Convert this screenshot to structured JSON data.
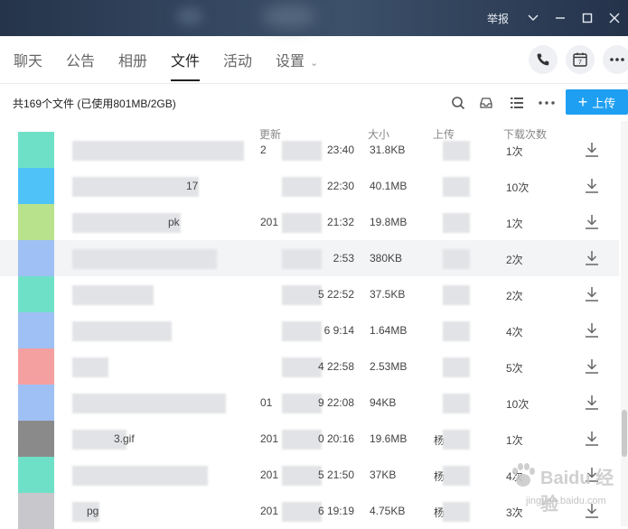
{
  "window": {
    "report_label": "举报",
    "controls": [
      "chevron-down-icon",
      "minimize-icon",
      "maximize-icon",
      "close-icon"
    ]
  },
  "nav": {
    "tabs": [
      {
        "label": "聊天"
      },
      {
        "label": "公告"
      },
      {
        "label": "相册"
      },
      {
        "label": "文件",
        "active": true
      },
      {
        "label": "活动"
      },
      {
        "label": "设置"
      }
    ],
    "calendar_day": "7"
  },
  "toolbar": {
    "summary": "共169个文件 (已使用801MB/2GB)",
    "upload_label": "上传"
  },
  "table": {
    "headers": {
      "updated": "更新",
      "size": "大小",
      "uploader": "上传",
      "downloads": "下载次数"
    },
    "rows": [
      {
        "name": "",
        "time": "23:40",
        "size": "31.8KB",
        "uploader": "",
        "downloads": "1次",
        "thumb": "#6fe0c8",
        "date_prefix": "2"
      },
      {
        "name": "17",
        "time": "22:30",
        "size": "40.1MB",
        "uploader": "",
        "downloads": "10次",
        "thumb": "#4fc3f7",
        "date_prefix": ""
      },
      {
        "name": "pk",
        "time": "21:32",
        "size": "19.8MB",
        "uploader": "",
        "downloads": "1次",
        "thumb": "#b9e28c",
        "date_prefix": "201"
      },
      {
        "name": "",
        "time": "2:53",
        "size": "380KB",
        "uploader": "",
        "downloads": "2次",
        "thumb": "#9fc0f4",
        "date_prefix": ""
      },
      {
        "name": "",
        "time": "5 22:52",
        "size": "37.5KB",
        "uploader": "",
        "downloads": "2次",
        "thumb": "#6fe0c8",
        "date_prefix": ""
      },
      {
        "name": "",
        "time": "6 9:14",
        "size": "1.64MB",
        "uploader": "",
        "downloads": "4次",
        "thumb": "#9fc0f4",
        "date_prefix": ""
      },
      {
        "name": "",
        "time": "4 22:58",
        "size": "2.53MB",
        "uploader": "",
        "downloads": "5次",
        "thumb": "#f4a0a0",
        "date_prefix": ""
      },
      {
        "name": "",
        "time": "9 22:08",
        "size": "94KB",
        "uploader": "",
        "downloads": "10次",
        "thumb": "#9fc0f4",
        "date_prefix": "01"
      },
      {
        "name": "3.gif",
        "time": "0 20:16",
        "size": "19.6MB",
        "uploader": "杨",
        "downloads": "1次",
        "thumb": "#8a8a8a",
        "date_prefix": "201"
      },
      {
        "name": "",
        "time": "5 21:50",
        "size": "37KB",
        "uploader": "杨",
        "downloads": "4次",
        "thumb": "#6fe0c8",
        "date_prefix": "201"
      },
      {
        "name": "pg",
        "time": "6 19:19",
        "size": "4.75KB",
        "uploader": "杨",
        "downloads": "3次",
        "thumb": "#c8c8cc",
        "date_prefix": "201"
      }
    ]
  },
  "watermark": {
    "text": "Baidu 经验",
    "sub": "jingyan.baidu.com"
  }
}
